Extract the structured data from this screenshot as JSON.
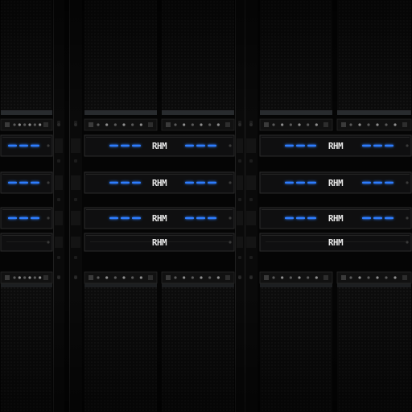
{
  "scene": {
    "subject": "server-rack-grid",
    "palette": {
      "background": "#050505",
      "panel": "#121212",
      "panel_edge": "#2b2b2b",
      "mesh": "#1a1a1a",
      "indicator_blue": "#2f7dff",
      "indicator_glow": "#79b6ff",
      "label_text": "#e7e7e7"
    }
  },
  "drive_bays": {
    "label_text": "RHM",
    "rows": 4,
    "columns": 4,
    "lit_rows": 3
  }
}
